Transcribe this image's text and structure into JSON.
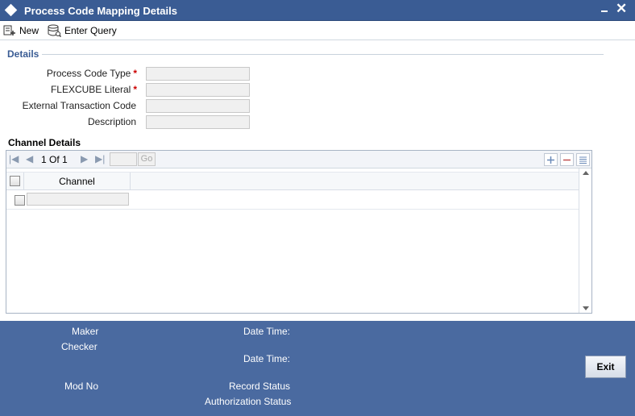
{
  "window": {
    "title": "Process Code Mapping Details"
  },
  "toolbar": {
    "new_label": "New",
    "enter_query_label": "Enter Query"
  },
  "details": {
    "section_title": "Details",
    "fields": [
      {
        "label": "Process Code Type",
        "required": true,
        "value": ""
      },
      {
        "label": "FLEXCUBE Literal",
        "required": true,
        "value": ""
      },
      {
        "label": "External Transaction Code",
        "required": false,
        "value": ""
      },
      {
        "label": "Description",
        "required": false,
        "value": ""
      }
    ],
    "required_marker": "*"
  },
  "channel_details": {
    "title": "Channel Details",
    "pagination": {
      "current": "1",
      "of_label": "Of",
      "total": "1",
      "go_label": "Go",
      "page_input": ""
    },
    "columns": [
      "Channel"
    ],
    "rows": [
      {
        "channel": ""
      }
    ]
  },
  "footer": {
    "maker_label": "Maker",
    "checker_label": "Checker",
    "datetime_label": "Date Time:",
    "modno_label": "Mod No",
    "record_status_label": "Record Status",
    "auth_status_label": "Authorization Status",
    "exit_label": "Exit"
  },
  "colors": {
    "title_bar": "#3a5c94",
    "footer": "#4a6aa0",
    "accent_text": "#3a5c94",
    "required": "#cc0000"
  }
}
